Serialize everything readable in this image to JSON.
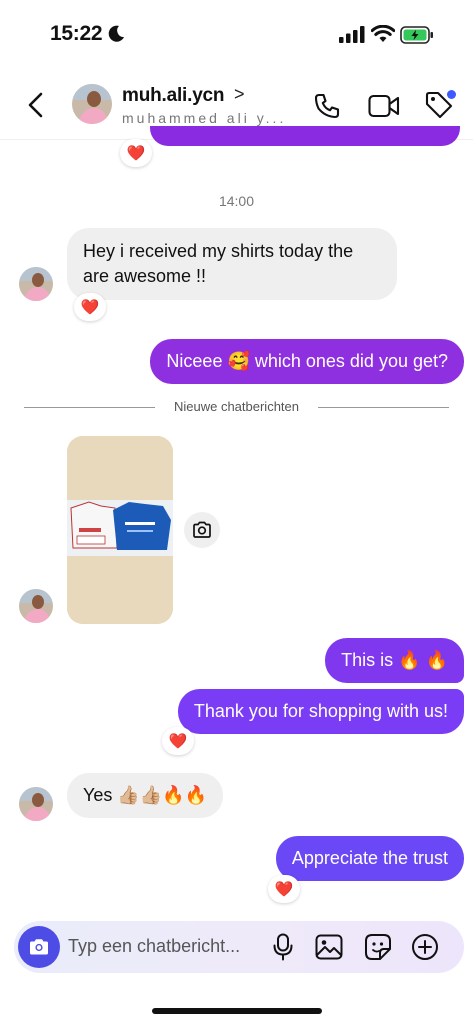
{
  "status_bar": {
    "time": "15:22"
  },
  "header": {
    "username": "muh.ali.ycn",
    "chevron": ">",
    "full_name": "muhammed ali y..."
  },
  "thread": {
    "timestamp": "14:00",
    "messages": [
      {
        "text_line1": "Hey i received my shirts today the",
        "text_line2": "are awesome !!"
      },
      {
        "text": "Niceee 🥰 which ones did you get?"
      },
      {
        "text": "This is 🔥 🔥"
      },
      {
        "text": "Thank you for shopping with us!"
      },
      {
        "text": "Yes 👍🏼👍🏼🔥🔥"
      },
      {
        "text": "Appreciate the trust"
      }
    ],
    "divider": "Nieuwe chatberichten",
    "reaction_emoji": "❤️"
  },
  "composer": {
    "placeholder": "Typ een chatbericht..."
  },
  "colors": {
    "outgoing_purple": "#8e2fe0",
    "outgoing_violet": "#7a3cf4",
    "incoming_gray": "#efefef",
    "composer_camera": "#4d4de6",
    "badge_dot": "#3b5bff"
  },
  "icons": [
    "moon-icon",
    "signal-icon",
    "wifi-icon",
    "battery-icon",
    "back-icon",
    "call-icon",
    "video-icon",
    "tag-icon",
    "camera-icon",
    "mic-icon",
    "gallery-icon",
    "sticker-icon",
    "plus-icon"
  ]
}
